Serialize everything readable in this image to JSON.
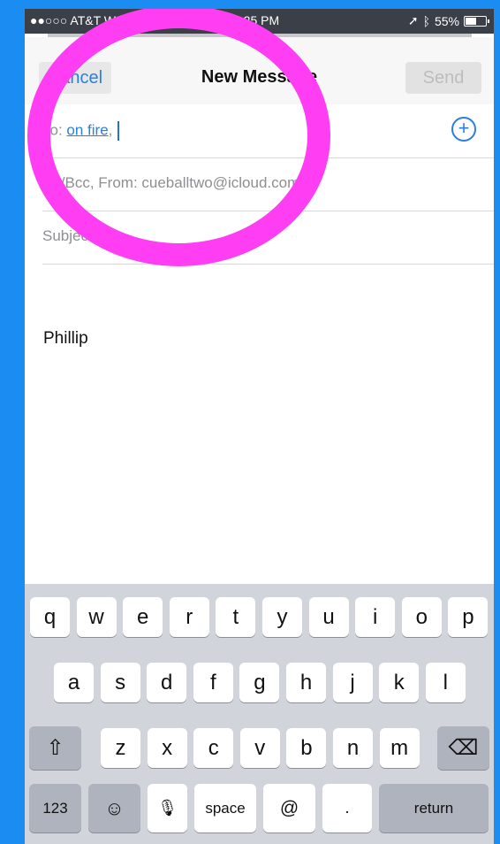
{
  "status": {
    "carrier": "●●○○○ AT&T W",
    "time": "3:25 PM",
    "battery": "55%",
    "battery_level": 0.55,
    "location_icon": "arrow-up-right-icon",
    "bluetooth_icon": "bluetooth-icon"
  },
  "nav": {
    "cancel": "Cancel",
    "title": "New Message",
    "send": "Send"
  },
  "fields": {
    "to_label": "To:",
    "to_recipient": "on fire",
    "to_sep": ",",
    "cc_text": "Cc/Bcc, From:  cueballtwo@icloud.com",
    "subject_label": "Subject:"
  },
  "body": {
    "text": "Phillip"
  },
  "keyboard": {
    "row1": [
      "q",
      "w",
      "e",
      "r",
      "t",
      "y",
      "u",
      "i",
      "o",
      "p"
    ],
    "row2": [
      "a",
      "s",
      "d",
      "f",
      "g",
      "h",
      "j",
      "k",
      "l"
    ],
    "row3": [
      "z",
      "x",
      "c",
      "v",
      "b",
      "n",
      "m"
    ],
    "shift_icon": "⇧",
    "delete_icon": "⌫",
    "emoji_icon": "☺",
    "mic_icon": "🎙",
    "numbers": "123",
    "space": "space",
    "at": "@",
    "period": ".",
    "return": "return"
  },
  "colors": {
    "accent": "#2a7fe0",
    "highlight": "#ff3df2",
    "background": "#1a8cf2"
  }
}
